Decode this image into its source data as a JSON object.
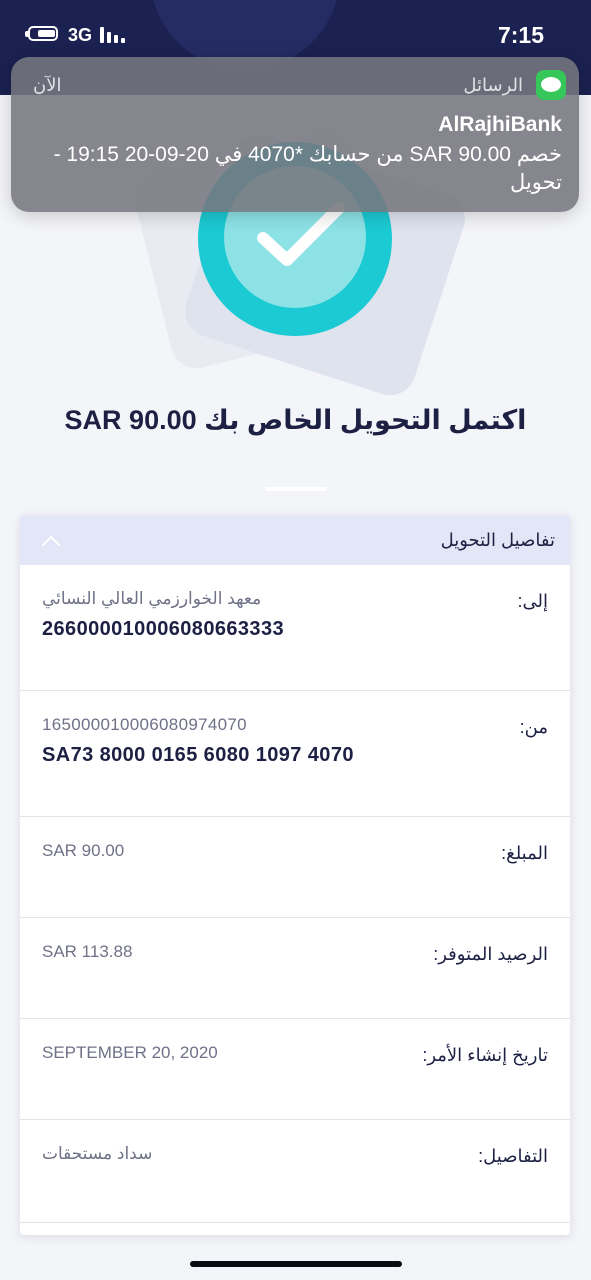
{
  "status_bar": {
    "network": "3G",
    "time": "7:15"
  },
  "notification": {
    "app_name": "الرسائل",
    "time": "الآن",
    "sender": "AlRajhiBank",
    "body": "خصم SAR 90.00 من حسابك *4070 في 20-09-20 19:15 - تحويل",
    "app_color": "#35c759"
  },
  "headline": "اكتمل التحويل الخاص بك SAR 90.00",
  "details": {
    "title": "تفاصيل التحويل",
    "rows": [
      {
        "label": "إلى:",
        "value": "معهد الخوارزمي العالي النسائي",
        "value2": "266000010006080663333"
      },
      {
        "label": "من:",
        "value": "165000010006080974070",
        "value2": "SA73 8000 0165 6080 1097 4070"
      },
      {
        "label": "المبلغ:",
        "value": "SAR 90.00"
      },
      {
        "label": "الرصيد المتوفر:",
        "value": "SAR 113.88"
      },
      {
        "label": "تاريخ إنشاء الأمر:",
        "value": "SEPTEMBER 20, 2020"
      },
      {
        "label": "التفاصيل:",
        "value": "سداد مستحقات"
      }
    ]
  },
  "colors": {
    "header_bg": "#1b2150",
    "accent": "#1ccad3",
    "text_dark": "#1d2043",
    "text_muted": "#6f7187"
  }
}
